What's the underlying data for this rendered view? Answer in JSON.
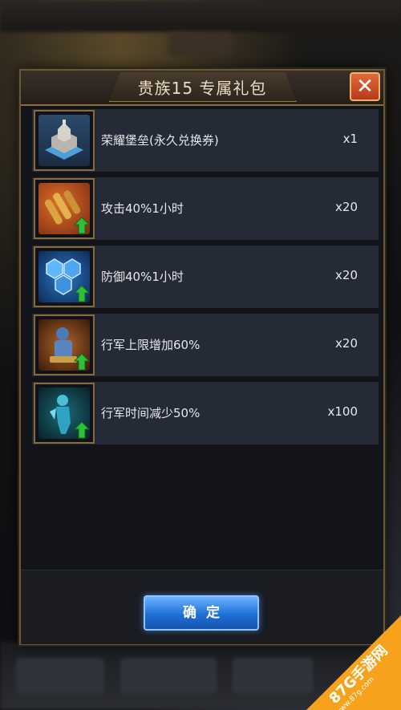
{
  "dialog": {
    "title": "贵族15 专属礼包",
    "close_label": "✕",
    "confirm_label": "确定"
  },
  "items": [
    {
      "name": "荣耀堡垒(永久兑换券)",
      "qty": "x1",
      "icon": "fortress-icon"
    },
    {
      "name": "攻击40%1小时",
      "qty": "x20",
      "icon": "ammo-attack-boost-icon"
    },
    {
      "name": "防御40%1小时",
      "qty": "x20",
      "icon": "hex-shield-defense-icon"
    },
    {
      "name": "行军上限增加60%",
      "qty": "x20",
      "icon": "march-capacity-icon"
    },
    {
      "name": "行军时间减少50%",
      "qty": "x100",
      "icon": "march-speed-icon"
    }
  ],
  "watermark": {
    "brand": "87G手游网",
    "url": "www.87g.com"
  },
  "colors": {
    "accent_gold": "#8a6a36",
    "confirm_blue": "#1f6fd6",
    "close_red": "#d04a24",
    "row_bg": "#252a37",
    "upgrade_green": "#2fbf3a"
  }
}
